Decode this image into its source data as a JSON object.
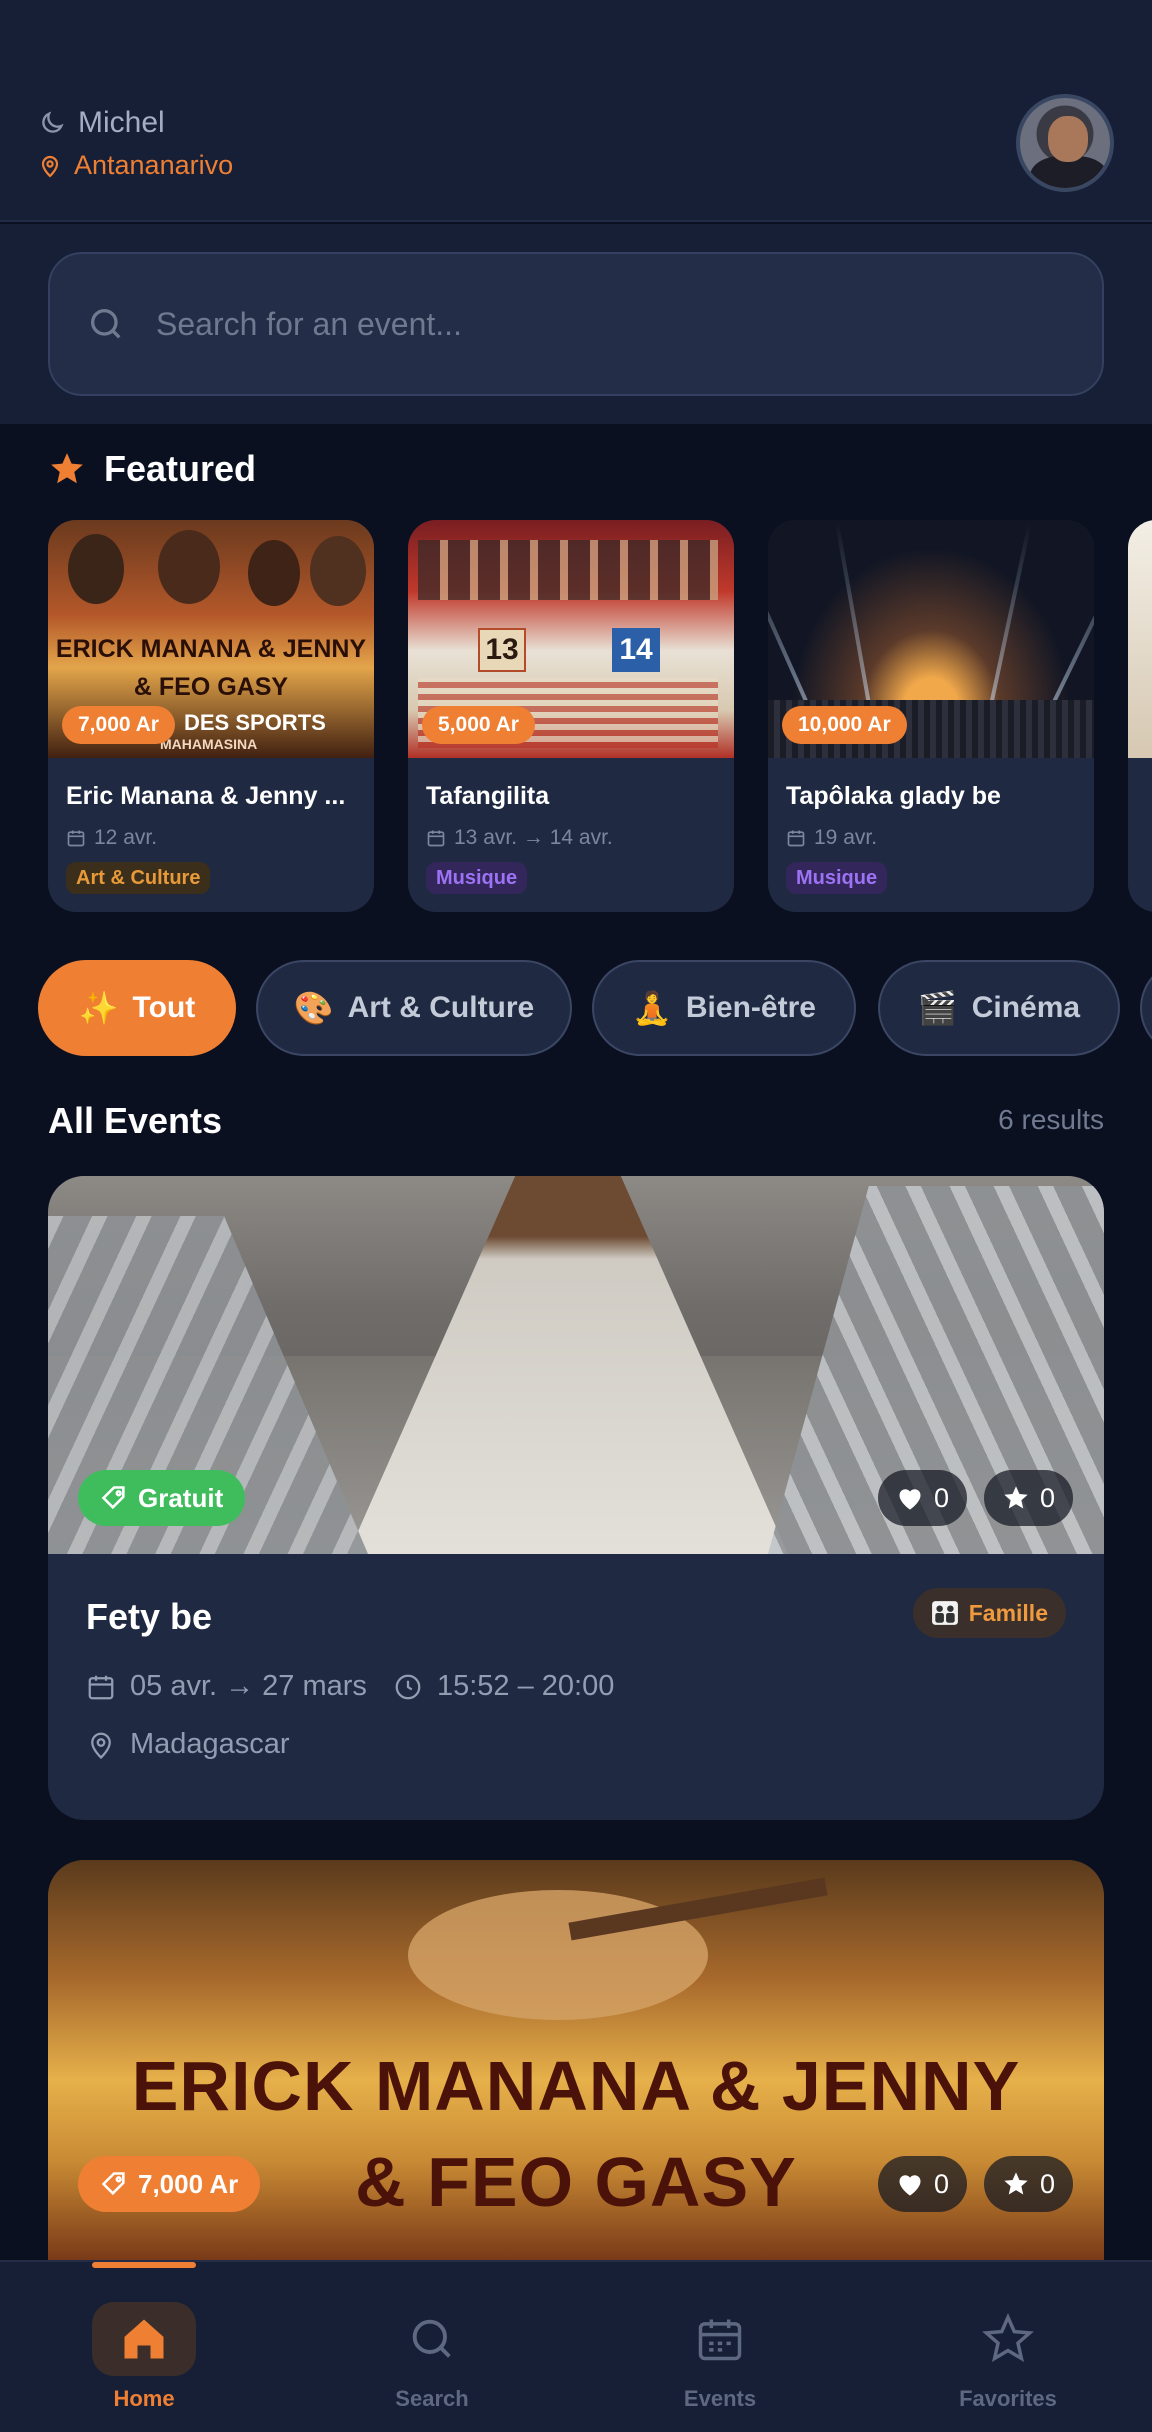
{
  "header": {
    "greeting": "Michel",
    "location": "Antananarivo"
  },
  "search": {
    "placeholder": "Search for an event..."
  },
  "featured": {
    "title": "Featured",
    "cards": [
      {
        "price": "7,000 Ar",
        "title": "Eric Manana & Jenny ...",
        "date": "12 avr.",
        "category": "Art & Culture"
      },
      {
        "price": "5,000 Ar",
        "title": "Tafangilita",
        "date": "13 avr. → 14 avr.",
        "category": "Musique"
      },
      {
        "price": "10,000 Ar",
        "title": "Tapôlaka glady be",
        "date": "19 avr.",
        "category": "Musique"
      }
    ]
  },
  "categories": [
    {
      "emoji": "✨",
      "label": "Tout",
      "active": true
    },
    {
      "emoji": "🎨",
      "label": "Art & Culture",
      "active": false
    },
    {
      "emoji": "🧘",
      "label": "Bien-être",
      "active": false
    },
    {
      "emoji": "🎬",
      "label": "Cinéma",
      "active": false
    }
  ],
  "all_events": {
    "title": "All Events",
    "count": "6 results",
    "events": [
      {
        "price": "Gratuit",
        "likes": "0",
        "stars": "0",
        "title": "Fety be",
        "badge": "Famille",
        "date": "05 avr. → 27 mars",
        "time": "15:52 – 20:00",
        "location": "Madagascar"
      },
      {
        "price": "7,000 Ar",
        "likes": "0",
        "stars": "0",
        "poster_line1": "ERICK MANANA & JENNY",
        "poster_line2": "& FEO GASY"
      }
    ]
  },
  "poster_text": {
    "erick_l1": "ERICK MANANA & JENNY",
    "erick_l2": "& FEO GASY",
    "erick_l3": "DES SPORTS",
    "erick_l4": "MAHAMASINA"
  },
  "nav": {
    "items": [
      {
        "label": "Home",
        "icon": "home-icon",
        "active": true
      },
      {
        "label": "Search",
        "icon": "search-icon",
        "active": false
      },
      {
        "label": "Events",
        "icon": "calendar-icon",
        "active": false
      },
      {
        "label": "Favorites",
        "icon": "star-icon",
        "active": false
      }
    ]
  },
  "colors": {
    "accent": "#ef7f33",
    "background": "#0b1020",
    "surface": "#1f2942",
    "free": "#3fbd5c"
  }
}
